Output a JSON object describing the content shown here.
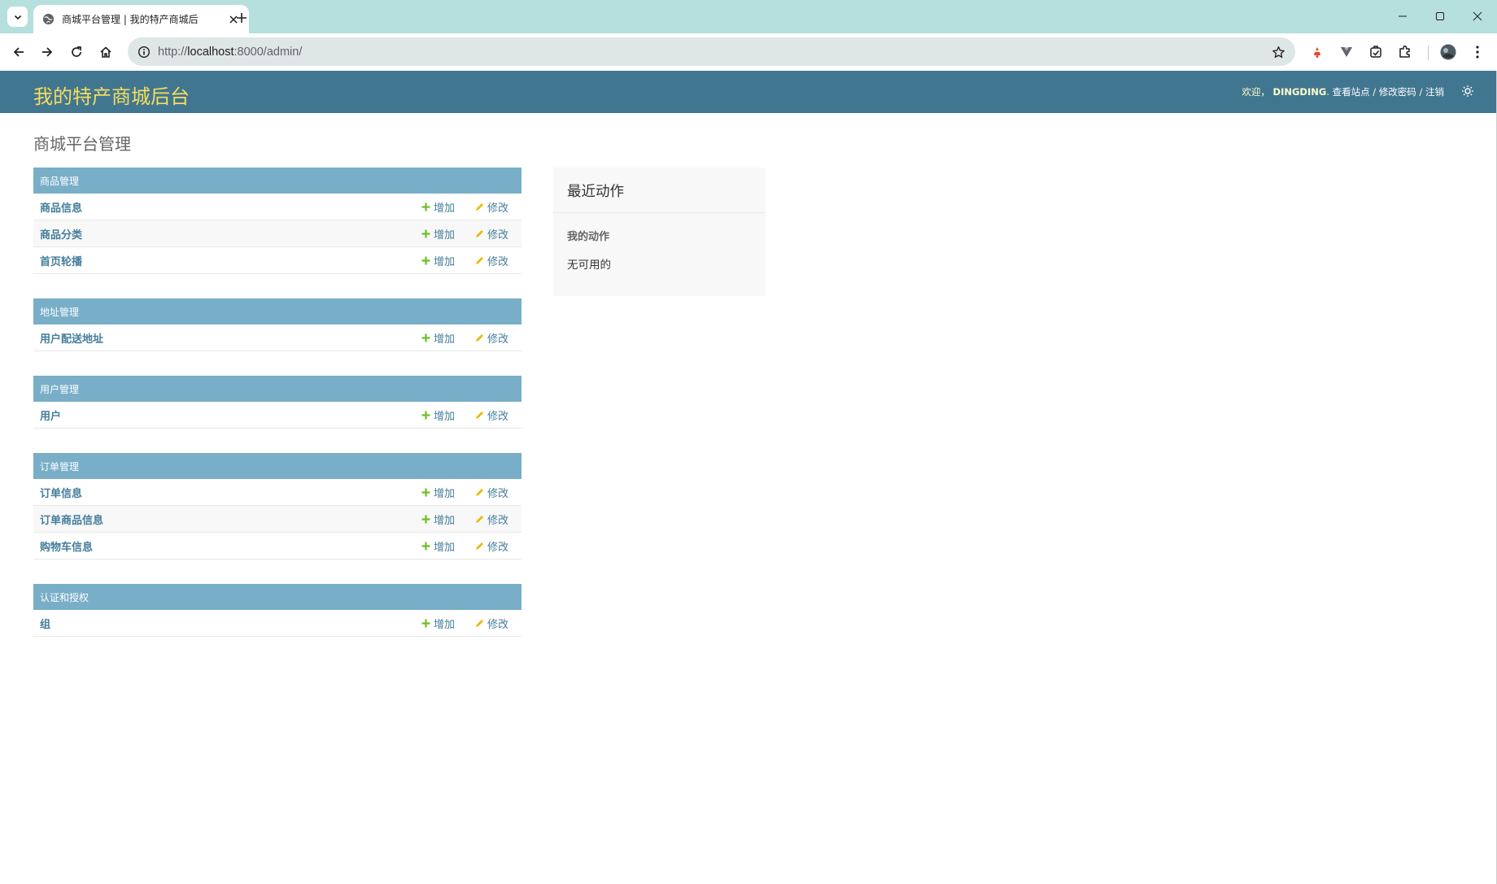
{
  "browser": {
    "tab_title": "商城平台管理 | 我的特产商城后",
    "url_scheme": "http://",
    "url_host": "localhost",
    "url_rest": ":8000/admin/"
  },
  "site": {
    "branding": "我的特产商城后台",
    "welcome": "欢迎，",
    "username": "DINGDING",
    "view_site": "查看站点",
    "change_password": "修改密码",
    "logout": "注销",
    "page_title": "商城平台管理"
  },
  "actions": {
    "add": "增加",
    "change": "修改"
  },
  "modules": [
    {
      "caption": "商品管理",
      "models": [
        "商品信息",
        "商品分类",
        "首页轮播"
      ]
    },
    {
      "caption": "地址管理",
      "models": [
        "用户配送地址"
      ]
    },
    {
      "caption": "用户管理",
      "models": [
        "用户"
      ]
    },
    {
      "caption": "订单管理",
      "models": [
        "订单信息",
        "订单商品信息",
        "购物车信息"
      ]
    },
    {
      "caption": "认证和授权",
      "models": [
        "组"
      ]
    }
  ],
  "recent_actions": {
    "title": "最近动作",
    "subtitle": "我的动作",
    "empty": "无可用的"
  },
  "colors": {
    "header_bg": "#417690",
    "branding": "#f5dd5d",
    "module_caption_bg": "#79aec8",
    "link": "#447e9b",
    "add_icon": "#70bf2b",
    "change_icon": "#efb80b",
    "tabbar_bg": "#b5e0de"
  },
  "icons": {
    "tab_list": "chevron-down-icon",
    "favicon": "globe-icon",
    "tab_close": "close-icon",
    "new_tab": "plus-icon",
    "back": "arrow-left-icon",
    "forward": "arrow-right-icon",
    "reload": "reload-icon",
    "home": "home-icon",
    "site_info": "info-icon",
    "bookmark": "star-icon",
    "add": "plus-icon",
    "change": "pencil-icon",
    "theme": "sun-icon"
  }
}
